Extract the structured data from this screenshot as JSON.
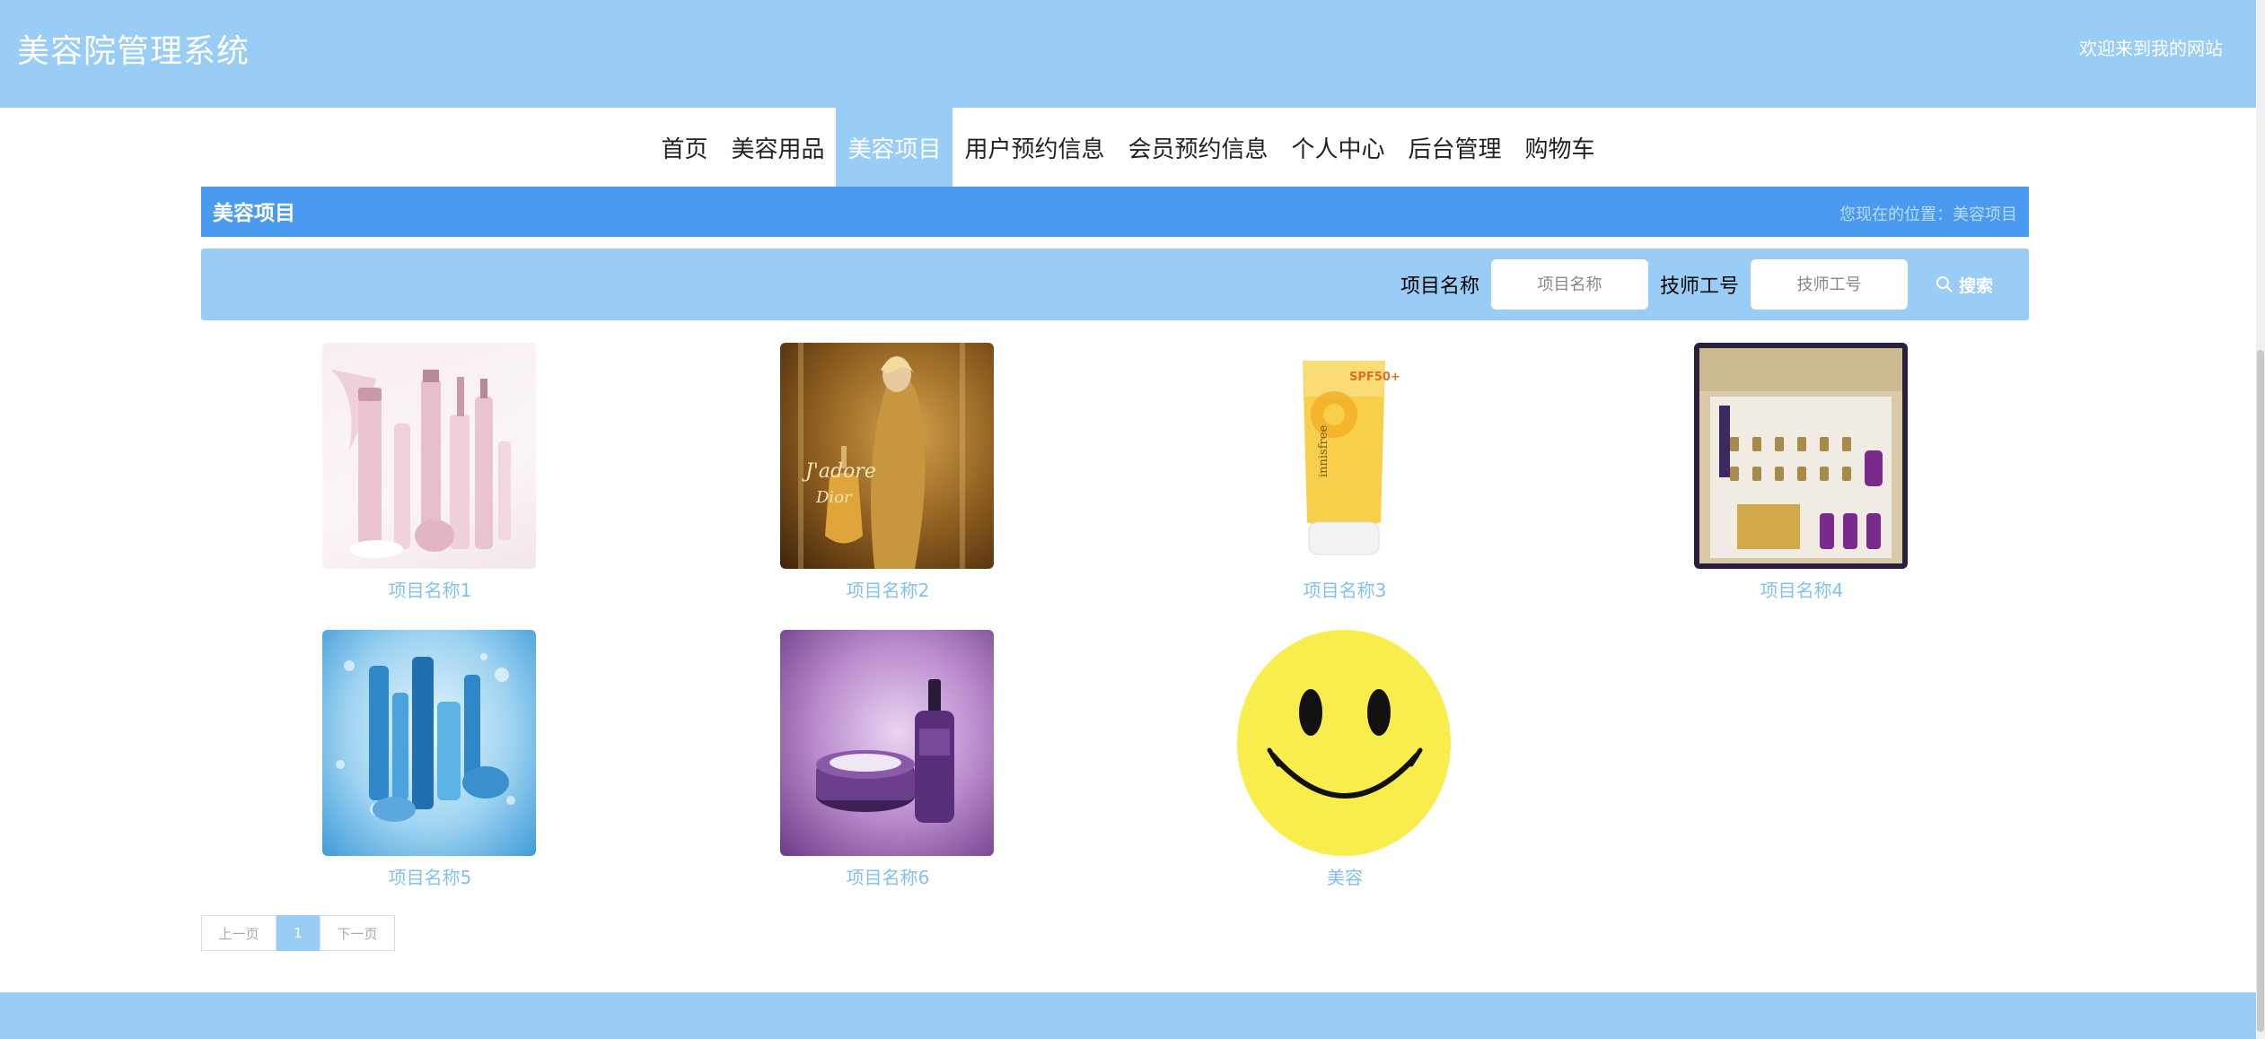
{
  "header": {
    "site_title": "美容院管理系统",
    "welcome": "欢迎来到我的网站"
  },
  "nav": {
    "items": [
      {
        "label": "首页",
        "active": false
      },
      {
        "label": "美容用品",
        "active": false
      },
      {
        "label": "美容项目",
        "active": true
      },
      {
        "label": "用户预约信息",
        "active": false
      },
      {
        "label": "会员预约信息",
        "active": false
      },
      {
        "label": "个人中心",
        "active": false
      },
      {
        "label": "后台管理",
        "active": false
      },
      {
        "label": "购物车",
        "active": false
      }
    ]
  },
  "title_bar": {
    "title": "美容项目",
    "breadcrumb": "您现在的位置：美容项目"
  },
  "search": {
    "name_label": "项目名称",
    "name_placeholder": "项目名称",
    "tech_label": "技师工号",
    "tech_placeholder": "技师工号",
    "button_label": "搜索"
  },
  "items": [
    {
      "name": "项目名称1",
      "image": "pink-skincare-products"
    },
    {
      "name": "项目名称2",
      "image": "jadore-perfume-ad"
    },
    {
      "name": "项目名称3",
      "image": "innisfree-sunscreen"
    },
    {
      "name": "项目名称4",
      "image": "skincare-gift-box"
    },
    {
      "name": "项目名称5",
      "image": "blue-skincare-splash"
    },
    {
      "name": "项目名称6",
      "image": "purple-serum-cream"
    },
    {
      "name": "美容",
      "image": "smiley-face"
    }
  ],
  "pagination": {
    "prev": "上一页",
    "current": "1",
    "next": "下一页"
  },
  "colors": {
    "header_bg": "#99cdf5",
    "title_bar_bg": "#4a9bf0",
    "label_color": "#84c0ee"
  }
}
